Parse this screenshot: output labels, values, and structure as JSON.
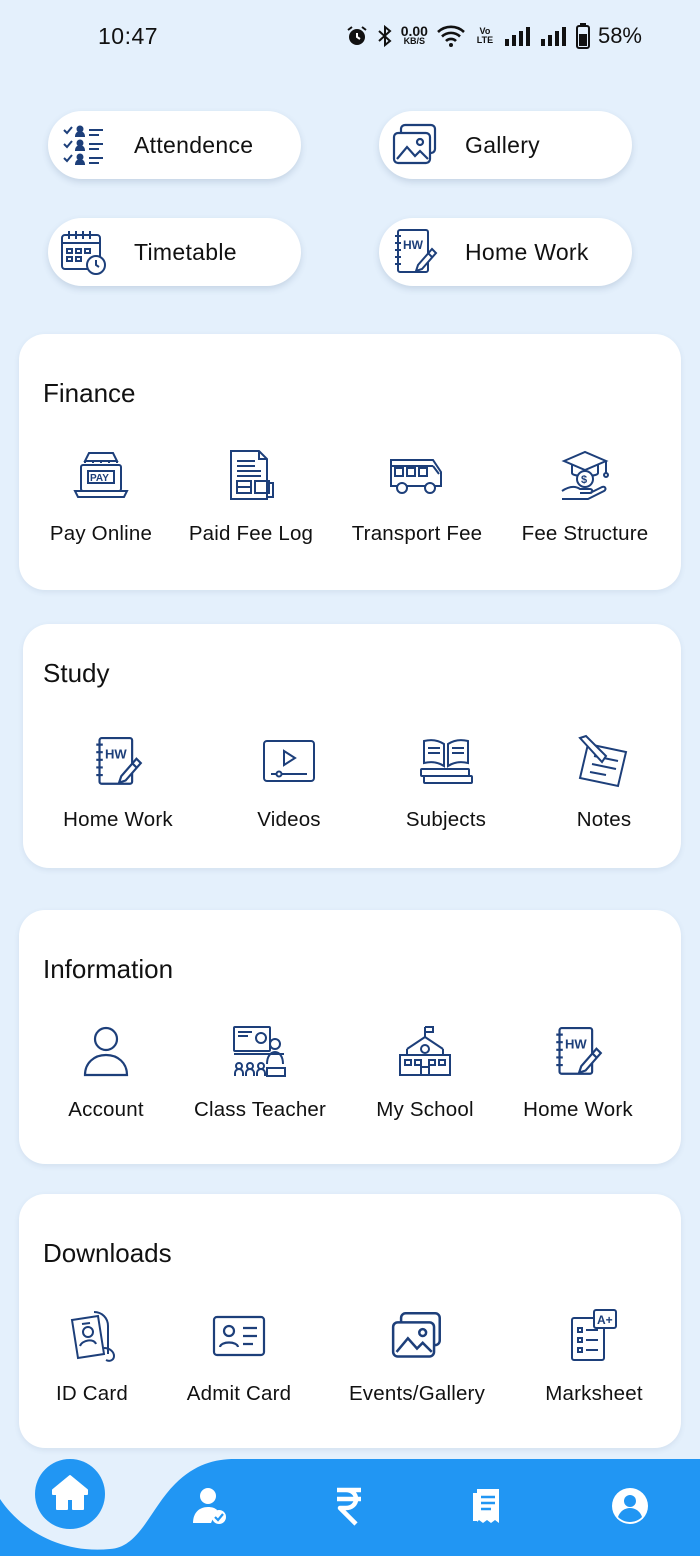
{
  "status": {
    "time": "10:47",
    "net_speed": "0.00",
    "net_unit": "KB/S",
    "volte_top": "Vo LTE",
    "battery": "58%"
  },
  "quick": [
    {
      "label": "Attendence",
      "icon": "attendance-list-icon"
    },
    {
      "label": "Gallery",
      "icon": "gallery-icon"
    },
    {
      "label": "Timetable",
      "icon": "calendar-clock-icon"
    },
    {
      "label": "Home Work",
      "icon": "homework-notebook-icon"
    }
  ],
  "sections": {
    "finance": {
      "title": "Finance",
      "items": [
        {
          "label": "Pay Online",
          "icon": "pay-laptop-icon"
        },
        {
          "label": "Paid Fee Log",
          "icon": "receipt-log-icon"
        },
        {
          "label": "Transport Fee",
          "icon": "bus-icon"
        },
        {
          "label": "Fee Structure",
          "icon": "graduation-fee-icon"
        }
      ]
    },
    "study": {
      "title": "Study",
      "items": [
        {
          "label": "Home Work",
          "icon": "homework-notebook-icon"
        },
        {
          "label": "Videos",
          "icon": "video-player-icon"
        },
        {
          "label": "Subjects",
          "icon": "books-icon"
        },
        {
          "label": "Notes",
          "icon": "notes-pencil-icon"
        }
      ]
    },
    "information": {
      "title": "Information",
      "items": [
        {
          "label": "Account",
          "icon": "account-user-icon"
        },
        {
          "label": "Class Teacher",
          "icon": "class-teacher-icon"
        },
        {
          "label": "My School",
          "icon": "school-building-icon"
        },
        {
          "label": "Home Work",
          "icon": "homework-notebook-icon"
        }
      ]
    },
    "downloads": {
      "title": "Downloads",
      "items": [
        {
          "label": "ID Card",
          "icon": "id-badge-icon"
        },
        {
          "label": "Admit Card",
          "icon": "admit-card-icon"
        },
        {
          "label": "Events/Gallery",
          "icon": "gallery-icon"
        },
        {
          "label": "Marksheet",
          "icon": "marksheet-icon"
        }
      ]
    }
  },
  "nav": [
    {
      "icon": "home-icon",
      "active": true
    },
    {
      "icon": "student-verified-icon"
    },
    {
      "icon": "rupee-icon"
    },
    {
      "icon": "receipt-icon"
    },
    {
      "icon": "profile-icon"
    }
  ],
  "colors": {
    "background": "#e4f0fc",
    "accent": "#2196f3",
    "icon_stroke": "#1d3f7a"
  }
}
